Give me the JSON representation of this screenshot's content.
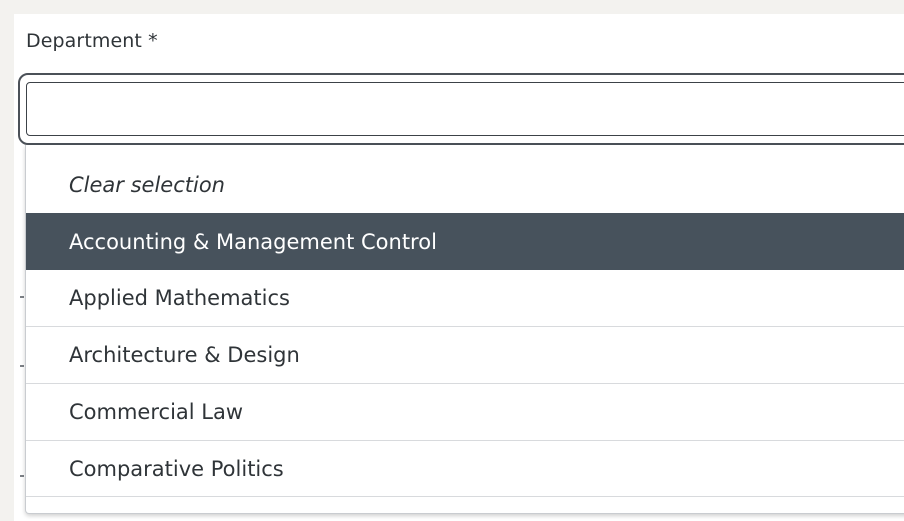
{
  "field": {
    "label": "Department *",
    "value": "",
    "placeholder": ""
  },
  "dropdown": {
    "clear_label": "Clear selection",
    "active_index": 0,
    "options": [
      "Accounting & Management Control",
      "Applied Mathematics",
      "Architecture & Design",
      "Commercial Law",
      "Comparative Politics"
    ]
  },
  "colors": {
    "active_background": "#47525c",
    "active_text": "#ffffff",
    "page_background": "#f3f2ef"
  }
}
